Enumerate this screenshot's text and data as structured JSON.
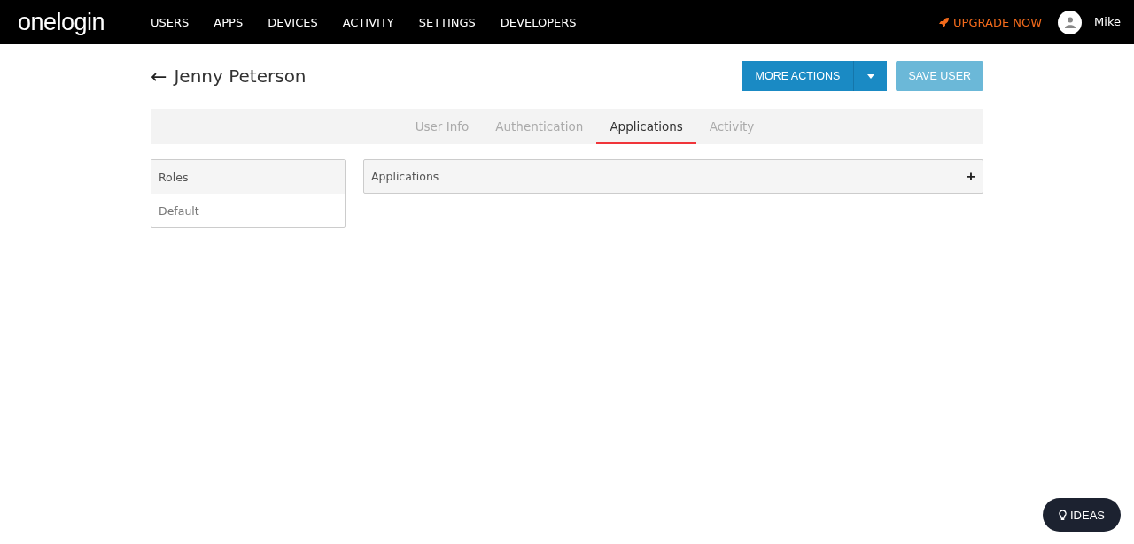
{
  "nav": {
    "logo": "onelogin",
    "items": [
      {
        "label": "USERS"
      },
      {
        "label": "APPS"
      },
      {
        "label": "DEVICES"
      },
      {
        "label": "ACTIVITY"
      },
      {
        "label": "SETTINGS"
      },
      {
        "label": "DEVELOPERS"
      }
    ],
    "upgrade": "UPGRADE NOW",
    "user": "Mike"
  },
  "header": {
    "back": "←",
    "title": "Jenny Peterson",
    "more_actions": "MORE ACTIONS",
    "save": "SAVE USER",
    "save_disabled": true
  },
  "tabs": [
    {
      "label": "User Info",
      "selected": false
    },
    {
      "label": "Authentication",
      "selected": false
    },
    {
      "label": "Applications",
      "selected": true
    },
    {
      "label": "Activity",
      "selected": false
    }
  ],
  "roles": {
    "title": "Roles",
    "items": [
      "Default"
    ]
  },
  "applications": {
    "title": "Applications",
    "add": "+"
  },
  "ideas": "IDEAS"
}
